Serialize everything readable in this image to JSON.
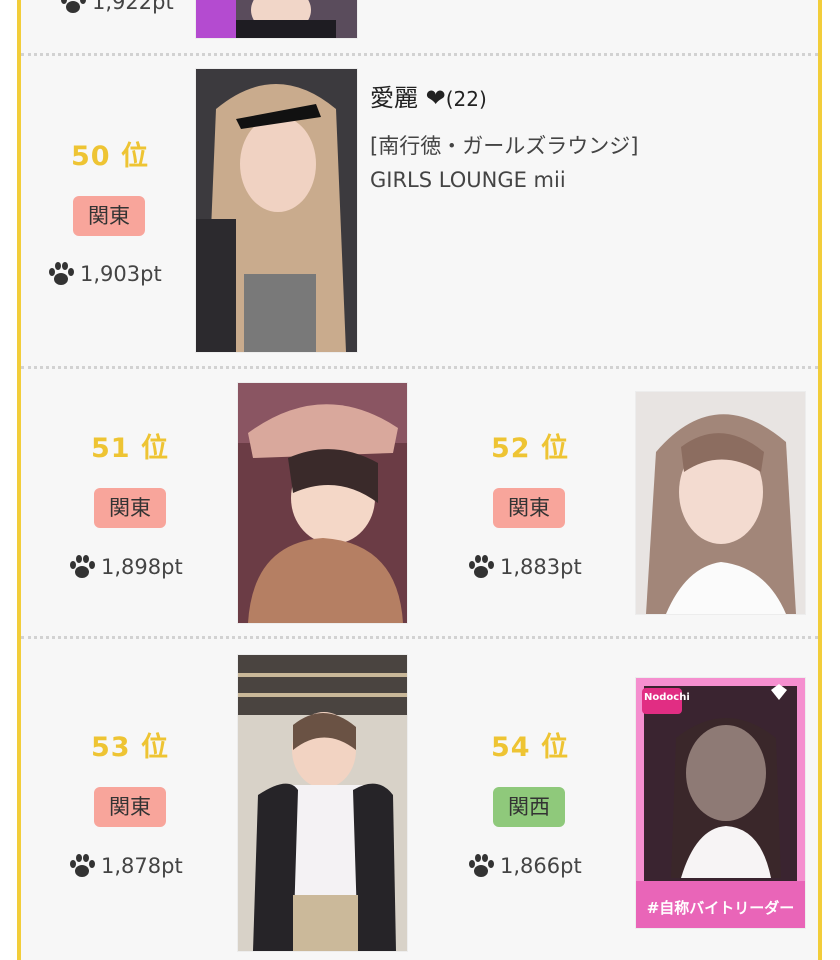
{
  "top_partial": {
    "points": "1,922pt"
  },
  "featured": {
    "rank": "50 位",
    "region": "関東",
    "points": "1,903pt",
    "name": "愛麗 ❤",
    "age": "(22)",
    "location": "[南行徳・ガールズラウンジ]",
    "store": "GIRLS LOUNGE mii"
  },
  "entries": [
    {
      "rank": "51 位",
      "region": "関東",
      "points": "1,898pt"
    },
    {
      "rank": "52 位",
      "region": "関東",
      "points": "1,883pt"
    },
    {
      "rank": "53 位",
      "region": "関東",
      "points": "1,878pt"
    },
    {
      "rank": "54 位",
      "region": "関西",
      "points": "1,866pt"
    }
  ],
  "photo_54": {
    "badge": "Nodochi",
    "caption": "#自称バイトリーダー"
  },
  "colors": {
    "border": "#f2cd3a",
    "rank": "#eec433",
    "kanto": "#f8a59b",
    "kansai": "#8fc97b"
  }
}
